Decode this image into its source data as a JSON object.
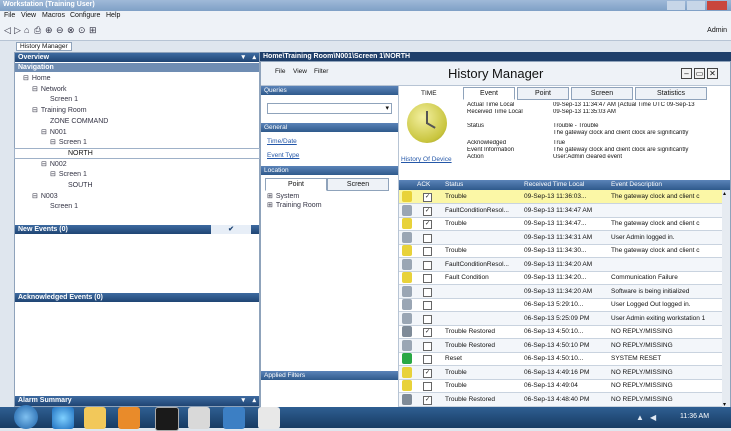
{
  "window": {
    "title": "Workstation (Training User)"
  },
  "menubar": {
    "items": [
      "File",
      "View",
      "Macros",
      "Configure",
      "Help"
    ]
  },
  "toolbar": {
    "user": "Admin"
  },
  "tab_history": "History Manager",
  "left": {
    "overview_title": "Overview",
    "navigation_title": "Navigation",
    "tree": [
      {
        "label": "Home",
        "indent": 0,
        "mark": "⊟"
      },
      {
        "label": "Network",
        "indent": 1,
        "mark": "⊟"
      },
      {
        "label": "Screen 1",
        "indent": 3,
        "mark": ""
      },
      {
        "label": "Training Room",
        "indent": 1,
        "mark": "⊟"
      },
      {
        "label": "ZONE COMMAND",
        "indent": 3,
        "mark": ""
      },
      {
        "label": "N001",
        "indent": 2,
        "mark": "⊟"
      },
      {
        "label": "Screen 1",
        "indent": 3,
        "mark": "⊟"
      },
      {
        "label": "NORTH",
        "indent": 5,
        "mark": ""
      },
      {
        "label": "N002",
        "indent": 2,
        "mark": "⊟"
      },
      {
        "label": "Screen 1",
        "indent": 3,
        "mark": "⊟"
      },
      {
        "label": "SOUTH",
        "indent": 5,
        "mark": ""
      },
      {
        "label": "N003",
        "indent": 1,
        "mark": "⊟"
      },
      {
        "label": "Screen 1",
        "indent": 3,
        "mark": ""
      }
    ],
    "new_events_title": "New Events (0)",
    "ack_events_title": "Acknowledged Events (0)",
    "alarm_summary_title": "Alarm Summary"
  },
  "path_bar": "Home\\Training Room\\N001\\Screen 1\\NORTH",
  "history": {
    "menu": [
      "File",
      "View",
      "Filter"
    ],
    "title": "History Manager",
    "queries_label": "Queries",
    "general_label": "General",
    "time_date_link": "Time/Date",
    "event_type_link": "Event Type",
    "location_label": "Location",
    "loc_tabs": [
      "Point",
      "Screen"
    ],
    "loc_tree": [
      "System",
      "Training Room"
    ],
    "applied_filters_label": "Applied Filters",
    "time_label": "TIME",
    "history_of_device": "History Of Device",
    "detail_tabs": [
      "Event",
      "Point",
      "Screen",
      "Statistics"
    ],
    "details": [
      {
        "label": "Actual Time Local",
        "value": "09-Sep-13 11:34:47 AM (Actual Time UTC 09-Sep-13"
      },
      {
        "label": "Received Time Local",
        "value": "09-Sep-13 11:35:03 AM"
      },
      {
        "label": "Status",
        "value": "Trouble - Trouble"
      },
      {
        "label": "",
        "value": "The gateway clock and client clock are significantly"
      },
      {
        "label": "Acknowledged",
        "value": "True"
      },
      {
        "label": "Event Information",
        "value": "The gateway clock and client clock are significantly"
      },
      {
        "label": "Action",
        "value": "User:Admin cleared event"
      }
    ],
    "columns": [
      "ACK",
      "Status",
      "Received Time Local",
      "Event Description"
    ],
    "rows": [
      {
        "icon": "#e8d23a",
        "ack": true,
        "status": "Trouble",
        "time": "09-Sep-13 11:36:03...",
        "desc": "The gateway clock and client c",
        "selected": true
      },
      {
        "icon": "#9aa6b4",
        "ack": true,
        "status": "FaultConditionResol...",
        "time": "09-Sep-13 11:34:47 AM",
        "desc": ""
      },
      {
        "icon": "#e8d23a",
        "ack": true,
        "status": "Trouble",
        "time": "09-Sep-13 11:34:47...",
        "desc": "The gateway clock and client c"
      },
      {
        "icon": "#9aa6b4",
        "ack": false,
        "status": "",
        "time": "09-Sep-13 11:34:31 AM",
        "desc": "User Admin logged in."
      },
      {
        "icon": "#e8d23a",
        "ack": false,
        "status": "Trouble",
        "time": "09-Sep-13 11:34:30...",
        "desc": "The gateway clock and client c"
      },
      {
        "icon": "#9aa6b4",
        "ack": false,
        "status": "FaultConditionResol...",
        "time": "09-Sep-13 11:34:20 AM",
        "desc": ""
      },
      {
        "icon": "#e8d23a",
        "ack": false,
        "status": "Fault Condition",
        "time": "09-Sep-13 11:34:20...",
        "desc": "Communication Failure"
      },
      {
        "icon": "#9aa6b4",
        "ack": false,
        "status": "",
        "time": "09-Sep-13 11:34:20 AM",
        "desc": "Software is being initialized"
      },
      {
        "icon": "#9aa6b4",
        "ack": false,
        "status": "",
        "time": "06-Sep-13 5:29:10...",
        "desc": "User Logged Out logged in."
      },
      {
        "icon": "#9aa6b4",
        "ack": false,
        "status": "",
        "time": "06-Sep-13 5:25:09 PM",
        "desc": "User Admin exiting workstation 1"
      },
      {
        "icon": "#7f8b98",
        "ack": true,
        "status": "Trouble Restored",
        "time": "06-Sep-13 4:50:10...",
        "desc": "NO REPLY/MISSING"
      },
      {
        "icon": "#9aa6b4",
        "ack": false,
        "status": "Trouble Restored",
        "time": "06-Sep-13 4:50:10 PM",
        "desc": "NO REPLY/MISSING"
      },
      {
        "icon": "#2aa845",
        "ack": false,
        "status": "Reset",
        "time": "06-Sep-13 4:50:10...",
        "desc": "SYSTEM RESET"
      },
      {
        "icon": "#e8d23a",
        "ack": true,
        "status": "Trouble",
        "time": "06-Sep-13 4:49:16 PM",
        "desc": "NO REPLY/MISSING"
      },
      {
        "icon": "#e8d23a",
        "ack": false,
        "status": "Trouble",
        "time": "06-Sep-13 4:49:04",
        "desc": "NO REPLY/MISSING"
      },
      {
        "icon": "#7f8b98",
        "ack": true,
        "status": "Trouble Restored",
        "time": "06-Sep-13 4:48:40 PM",
        "desc": "NO REPLY/MISSING"
      }
    ]
  },
  "taskbar": {
    "clock": "11:36 AM"
  },
  "colors": {
    "title_bar": "#1f4574",
    "selected_row": "#fbf7a6",
    "trouble": "#e8d23a",
    "reset": "#2aa845"
  }
}
